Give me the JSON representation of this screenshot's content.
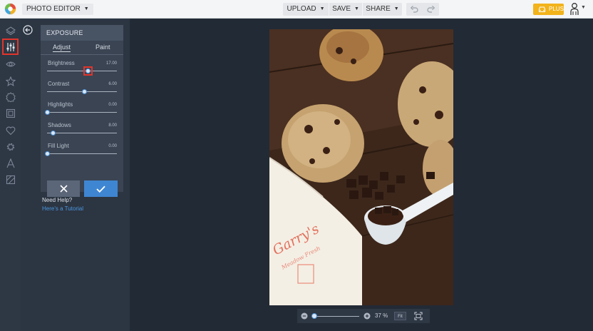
{
  "topbar": {
    "app_title": "PHOTO EDITOR",
    "upload_label": "UPLOAD",
    "save_label": "SAVE",
    "share_label": "SHARE",
    "plus_label": "PLUS"
  },
  "rail": {
    "icons": [
      "layers-icon",
      "adjust-sliders-icon",
      "eye-icon",
      "star-icon",
      "badge-icon",
      "frame-icon",
      "heart-icon",
      "gear-icon",
      "text-icon",
      "texture-icon"
    ],
    "active": "adjust-sliders-icon",
    "active_highlight_color": "#e2352b"
  },
  "panel": {
    "title": "EXPOSURE",
    "tabs": [
      {
        "label": "Adjust",
        "selected": true
      },
      {
        "label": "Paint",
        "selected": false
      }
    ],
    "sliders": [
      {
        "label": "Brightness",
        "value": "17.00",
        "position": 0.58
      },
      {
        "label": "Contrast",
        "value": "6.00",
        "position": 0.53
      },
      {
        "label": "Highlights",
        "value": "0.00",
        "position": 0.0
      },
      {
        "label": "Shadows",
        "value": "8.00",
        "position": 0.08
      },
      {
        "label": "Fill Light",
        "value": "0.00",
        "position": 0.0
      }
    ],
    "cancel_icon": "close-icon",
    "apply_icon": "check-icon",
    "accent_color": "#3f86d2"
  },
  "help": {
    "title": "Need Help?",
    "link": "Here's a Tutorial"
  },
  "canvas": {
    "photo_text": "Garry's",
    "photo_subtext": "Meadow Fresh"
  },
  "zoom": {
    "value": "37 %",
    "fit_label": "Fit",
    "position": 0.06
  }
}
